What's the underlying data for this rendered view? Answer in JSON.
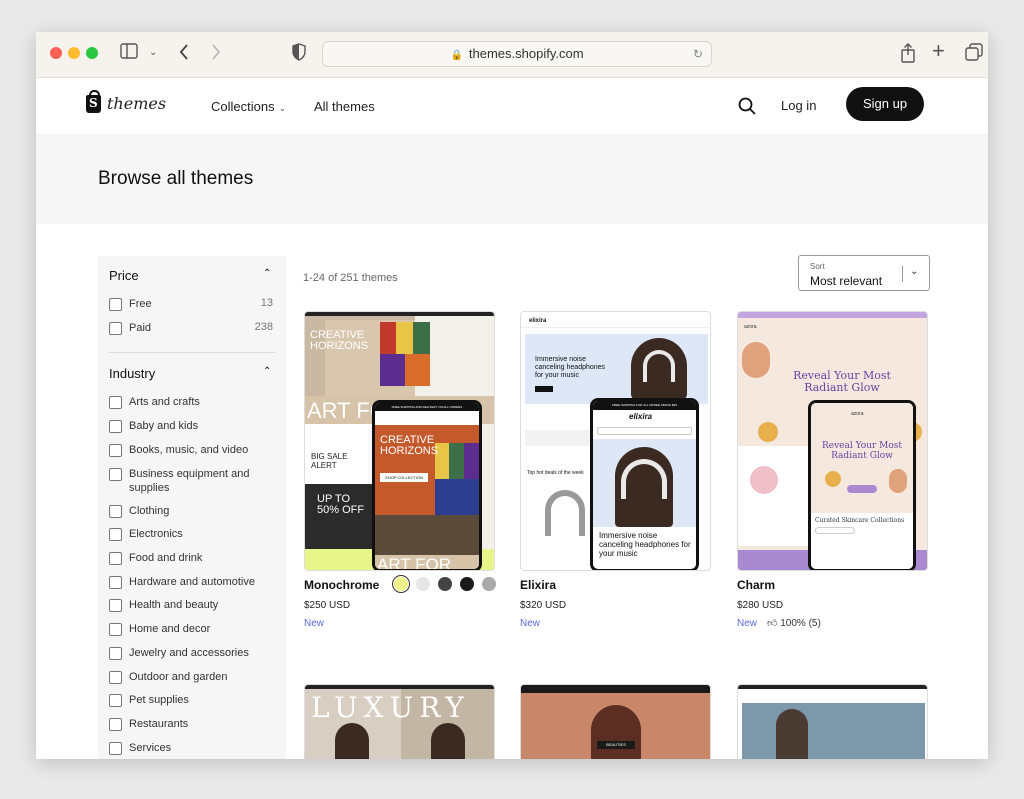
{
  "browser": {
    "url": "themes.shopify.com"
  },
  "header": {
    "logo_text": "themes",
    "nav": [
      {
        "label": "Collections",
        "has_menu": true
      },
      {
        "label": "All themes",
        "has_menu": false
      }
    ],
    "login_label": "Log in",
    "signup_label": "Sign up"
  },
  "page": {
    "title": "Browse all themes",
    "results_count": "1-24 of 251 themes"
  },
  "sort": {
    "label": "Sort",
    "value": "Most relevant"
  },
  "filters": {
    "price": {
      "title": "Price",
      "options": [
        {
          "label": "Free",
          "count": "13"
        },
        {
          "label": "Paid",
          "count": "238"
        }
      ]
    },
    "industry": {
      "title": "Industry",
      "options": [
        {
          "label": "Arts and crafts"
        },
        {
          "label": "Baby and kids"
        },
        {
          "label": "Books, music, and video"
        },
        {
          "label": "Business equipment and supplies"
        },
        {
          "label": "Clothing"
        },
        {
          "label": "Electronics"
        },
        {
          "label": "Food and drink"
        },
        {
          "label": "Hardware and automotive"
        },
        {
          "label": "Health and beauty"
        },
        {
          "label": "Home and decor"
        },
        {
          "label": "Jewelry and accessories"
        },
        {
          "label": "Outdoor and garden"
        },
        {
          "label": "Pet supplies"
        },
        {
          "label": "Restaurants"
        },
        {
          "label": "Services"
        }
      ]
    }
  },
  "themes": [
    {
      "name": "Monochrome",
      "price": "$250 USD",
      "badge": "New",
      "swatches": [
        "#eef28a",
        "#e6e6e6",
        "#444444",
        "#1a1a1a",
        "#a9a9a9"
      ],
      "preview": {
        "heading": "CREATIVE HORIZONS",
        "headline": "ART FO",
        "sale": "BIG SALE ALERT",
        "offer": "UP TO 50% OFF",
        "banner": "FREE SHIPPING AND DELIVERY ON ALL ORDERS",
        "phone_heading": "CREATIVE HORIZONS",
        "phone_button": "SHOP COLLECTION",
        "phone_footer": "ART FOR"
      }
    },
    {
      "name": "Elixira",
      "price": "$320 USD",
      "badge": "New",
      "preview": {
        "logo": "elixira",
        "headline": "Immersive noise canceling headphones for your music",
        "banner": "FREE SHIPPING FOR ALL ORDER ABOVE $99",
        "deals": "Top hot deals of the week",
        "phone_headline": "Immersive noise canceling headphones for your music"
      }
    },
    {
      "name": "Charm",
      "price": "$280 USD",
      "badge": "New",
      "rating": "100% (5)",
      "preview": {
        "logo": "azora",
        "headline": "Reveal Your Most Radiant Glow",
        "collections": "Curated Skincare Collections"
      }
    },
    {
      "name": "",
      "preview": {
        "headline": "LUXURY"
      }
    },
    {
      "name": "",
      "preview": {
        "headline": "BEAUTIES"
      }
    },
    {
      "name": "",
      "preview": {
        "headline": ""
      }
    }
  ]
}
